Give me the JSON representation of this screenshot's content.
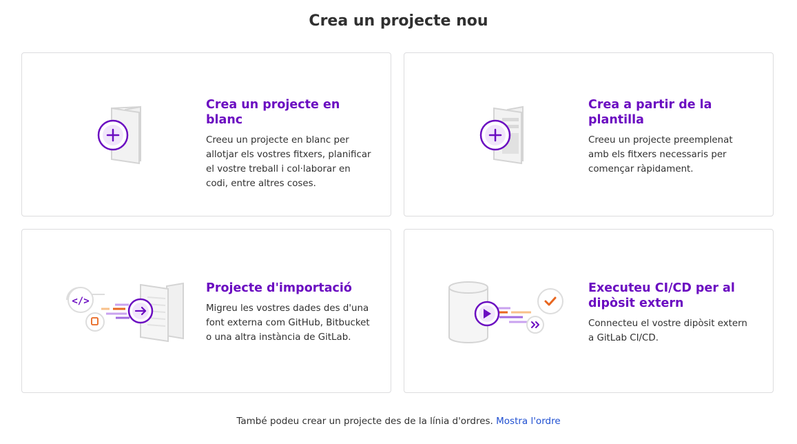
{
  "page": {
    "title": "Crea un projecte nou"
  },
  "cards": [
    {
      "title": "Crea un projecte en blanc",
      "description": "Creeu un projecte en blanc per allotjar els vostres fitxers, planificar el vostre treball i col·laborar en codi, entre altres coses.",
      "icon": "blank-project-illustration"
    },
    {
      "title": "Crea a partir de la plantilla",
      "description": "Creeu un projecte preemplenat amb els fitxers necessaris per començar ràpidament.",
      "icon": "template-project-illustration"
    },
    {
      "title": "Projecte d'importació",
      "description": "Migreu les vostres dades des d'una font externa com GitHub, Bitbucket o una altra instància de GitLab.",
      "icon": "import-project-illustration"
    },
    {
      "title": "Executeu CI/CD per al dipòsit extern",
      "description": "Connecteu el vostre dipòsit extern a GitLab CI/CD.",
      "icon": "ci-cd-project-illustration"
    }
  ],
  "footer": {
    "text": "També podeu crear un projecte des de la línia d'ordres.",
    "link_label": "Mostra l'ordre"
  },
  "colors": {
    "accent": "#6b0cc1",
    "link": "#1f4fd1",
    "orange": "#e8661f",
    "border": "#dcdcde"
  }
}
